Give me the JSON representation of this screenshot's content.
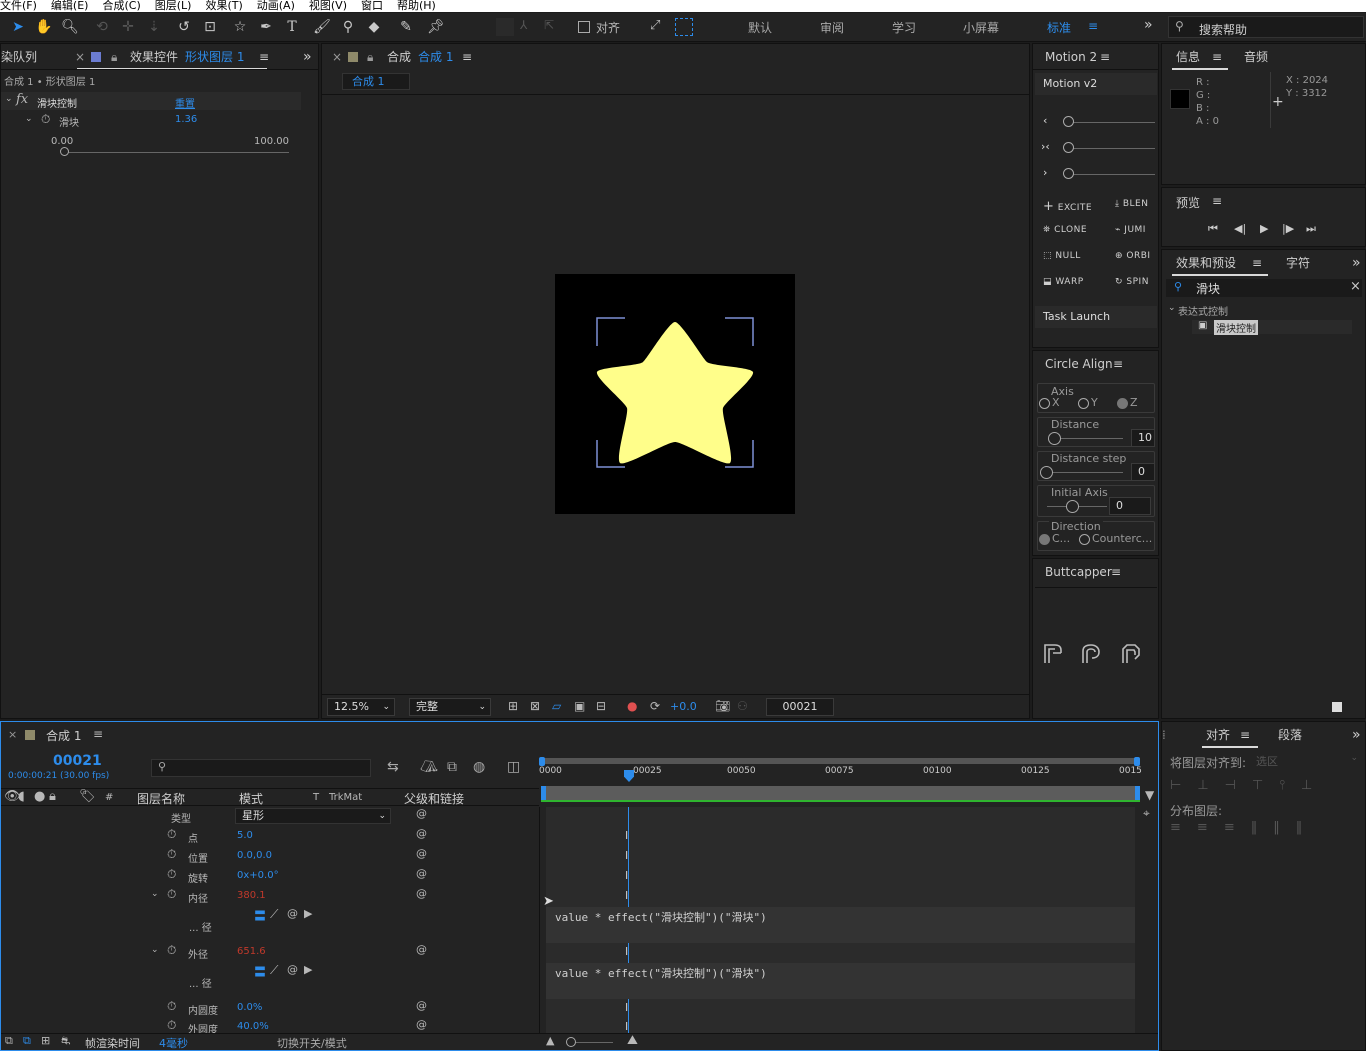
{
  "menu": [
    "文件(F)",
    "编辑(E)",
    "合成(C)",
    "图层(L)",
    "效果(T)",
    "动画(A)",
    "视图(V)",
    "窗口",
    "帮助(H)"
  ],
  "toolbar": {
    "snap_label": "对齐",
    "workspaces": [
      "默认",
      "审阅",
      "学习",
      "小屏幕",
      "标准"
    ],
    "active_workspace": "标准",
    "search_placeholder": "搜索帮助"
  },
  "effect_panel": {
    "tab_left": "染队列",
    "tab_label": "效果控件",
    "tab_layer": "形状图层 1",
    "breadcrumb": "合成 1 • 形状图层 1",
    "effect_name": "滑块控制",
    "reset_label": "重置",
    "param_name": "滑块",
    "param_value": "1.36",
    "range_min": "0.00",
    "range_max": "100.00",
    "slider_fraction": 0.0136
  },
  "comp_panel": {
    "tab_prefix": "合成",
    "tab_comp": "合成 1",
    "subtab": "合成 1",
    "zoom": "12.5%",
    "quality": "完整",
    "exposure": "+0.0",
    "timecode": "00021"
  },
  "motion": {
    "title": "Motion 2",
    "subtitle": "Motion v2",
    "sliders": [
      "‹",
      "›‹",
      "›"
    ],
    "buttons": [
      "EXCITE",
      "BLEN",
      "CLONE",
      "JUMI",
      "NULL",
      "ORBI",
      "WARP",
      "SPIN"
    ],
    "task_launch": "Task Launch"
  },
  "circle_align": {
    "title": "Circle Align",
    "axis_label": "Axis",
    "axis_options": [
      "X",
      "Y",
      "Z"
    ],
    "distance_label": "Distance",
    "distance_value": "10",
    "distance_step_label": "Distance step",
    "distance_step_value": "0",
    "initial_axis_label": "Initial Axis",
    "initial_axis_value": "0",
    "direction_label": "Direction",
    "direction_options": [
      "C...",
      "Counterc..."
    ]
  },
  "buttcapper": {
    "title": "Buttcapper"
  },
  "info_panel": {
    "tab_info": "信息",
    "tab_audio": "音频",
    "r": "R :",
    "g": "G :",
    "b": "B :",
    "a": "A : 0",
    "x": "X : 2024",
    "y": "Y : 3312"
  },
  "preview_panel": {
    "title": "预览"
  },
  "effects_presets": {
    "tab": "效果和预设",
    "tab2": "字符",
    "search_value": "滑块",
    "category": "表达式控制",
    "item": "滑块控制"
  },
  "align_panel": {
    "tab": "对齐",
    "tab2": "段落",
    "align_to_label": "将图层对齐到:",
    "align_to_value": "选区",
    "distribute_label": "分布图层:"
  },
  "timeline": {
    "tab": "合成 1",
    "timecode": "00021",
    "timecode_sub": "0:00:00:21 (30.00 fps)",
    "ruler": [
      "0000",
      "00025",
      "00050",
      "00075",
      "00100",
      "00125",
      "0015"
    ],
    "columns": {
      "hash": "#",
      "layer_name": "图层名称",
      "mode": "模式",
      "t": "T",
      "trkmat": "TrkMat",
      "parent": "父级和链接"
    },
    "rows": [
      {
        "name": "类型",
        "value": "星形",
        "type": "dropdown"
      },
      {
        "name": "点",
        "value": "5.0"
      },
      {
        "name": "位置",
        "value": "0.0,0.0"
      },
      {
        "name": "旋转",
        "value": "0x+0.0°"
      },
      {
        "name": "内径",
        "value": "380.1",
        "red": true
      },
      {
        "name": "... 径",
        "expr": "value * effect(\"滑块控制\")(\"滑块\")"
      },
      {
        "name": "外径",
        "value": "651.6",
        "red": true
      },
      {
        "name": "... 径",
        "expr": "value * effect(\"滑块控制\")(\"滑块\")"
      },
      {
        "name": "内圆度",
        "value": "0.0%"
      },
      {
        "name": "外圆度",
        "value": "40.0%"
      }
    ],
    "footer_render_label": "帧渲染时间",
    "footer_render_value": "4毫秒",
    "footer_toggle": "切换开关/模式"
  },
  "colors": {
    "accent": "#2d8ceb",
    "star": "#fffe8a",
    "bg": "#232323",
    "work_area": "#2fb52f"
  }
}
